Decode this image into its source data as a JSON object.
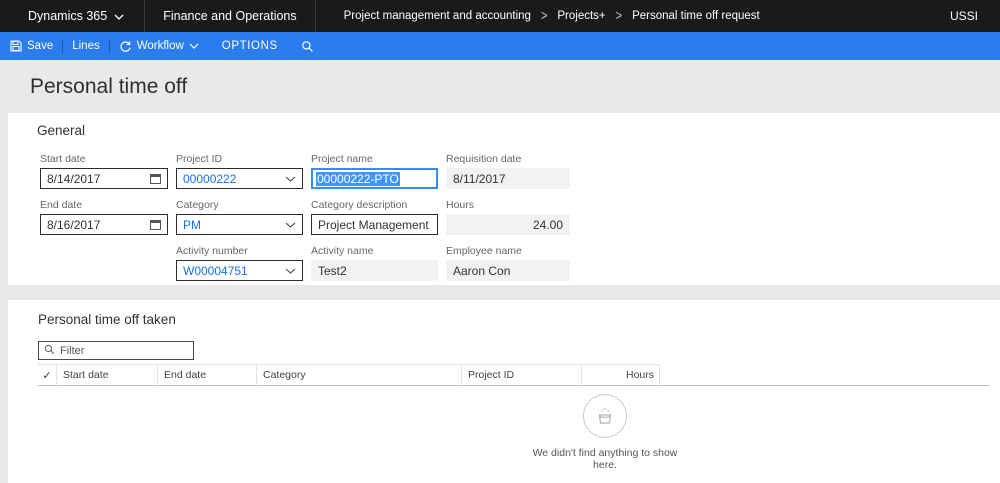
{
  "topbar": {
    "app": "Dynamics 365",
    "product": "Finance and Operations",
    "breadcrumb": [
      "Project management and accounting",
      "Projects+",
      "Personal time off request"
    ],
    "crumb_sep": ">",
    "environment": "USSI"
  },
  "commandbar": {
    "save": "Save",
    "lines": "Lines",
    "workflow": "Workflow",
    "options": "OPTIONS"
  },
  "page": {
    "title": "Personal time off"
  },
  "general": {
    "heading": "General",
    "fields": {
      "start_date": {
        "label": "Start date",
        "value": "8/14/2017"
      },
      "project_id": {
        "label": "Project ID",
        "value": "00000222"
      },
      "project_name": {
        "label": "Project name",
        "value": "00000222-PTO"
      },
      "requisition_date": {
        "label": "Requisition date",
        "value": "8/11/2017"
      },
      "end_date": {
        "label": "End date",
        "value": "8/16/2017"
      },
      "category": {
        "label": "Category",
        "value": "PM"
      },
      "category_description": {
        "label": "Category description",
        "value": "Project Management"
      },
      "hours": {
        "label": "Hours",
        "value": "24.00"
      },
      "activity_number": {
        "label": "Activity number",
        "value": "W00004751"
      },
      "activity_name": {
        "label": "Activity name",
        "value": "Test2"
      },
      "employee_name": {
        "label": "Employee name",
        "value": "Aaron Con"
      }
    }
  },
  "pto_taken": {
    "heading": "Personal time off taken",
    "filter_placeholder": "Filter",
    "check_glyph": "✓",
    "columns": [
      "Start date",
      "End date",
      "Category",
      "Project ID",
      "Hours"
    ],
    "rows": [],
    "empty_message": "We didn't find anything to show here."
  },
  "colors": {
    "topbar_bg": "#1a1a1a",
    "commandbar_bg": "#2b7cec",
    "lookup_link": "#1673e6",
    "selection_bg": "#3f97fb",
    "page_bg": "#e9e9e9"
  }
}
